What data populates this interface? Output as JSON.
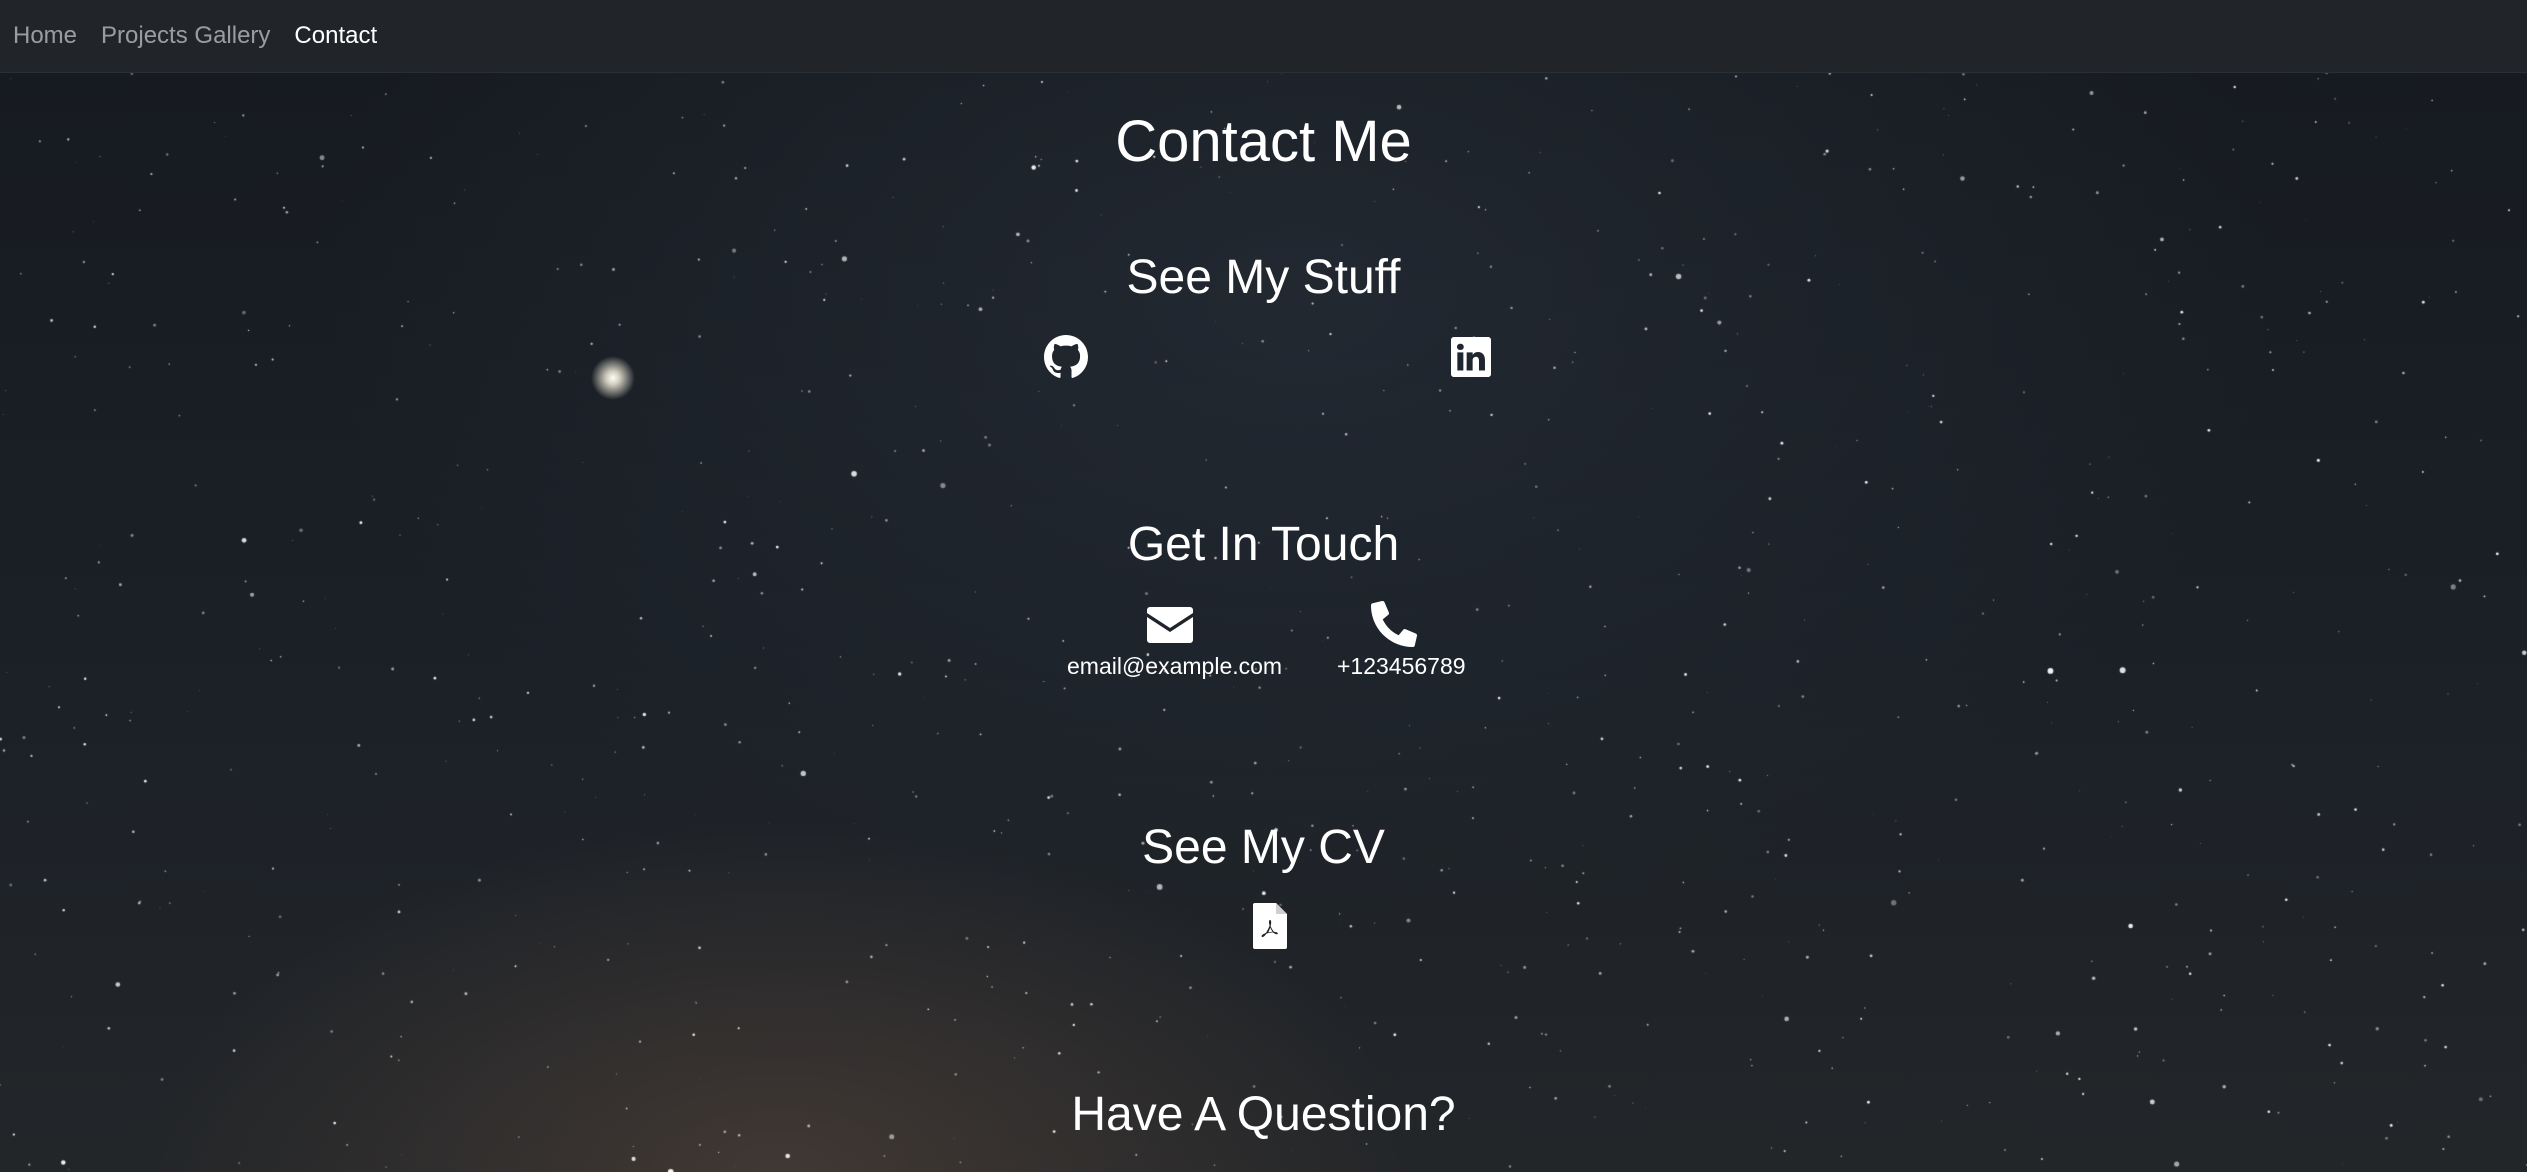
{
  "nav": {
    "items": [
      {
        "label": "Home",
        "active": false
      },
      {
        "label": "Projects Gallery",
        "active": false
      },
      {
        "label": "Contact",
        "active": true
      }
    ]
  },
  "page": {
    "title": "Contact Me"
  },
  "sections": {
    "stuff": {
      "heading": "See My Stuff",
      "icons": [
        "github-icon",
        "linkedin-icon"
      ]
    },
    "touch": {
      "heading": "Get In Touch",
      "email": "email@example.com",
      "phone": "+123456789",
      "icons": [
        "envelope-icon",
        "phone-icon"
      ]
    },
    "cv": {
      "heading": "See My CV",
      "icons": [
        "pdf-file-icon"
      ]
    },
    "question": {
      "heading": "Have A Question?"
    }
  },
  "colors": {
    "navbar": "#212529",
    "nav_inactive": "rgba(255,255,255,0.55)",
    "nav_active": "#ffffff",
    "text": "#ffffff"
  }
}
